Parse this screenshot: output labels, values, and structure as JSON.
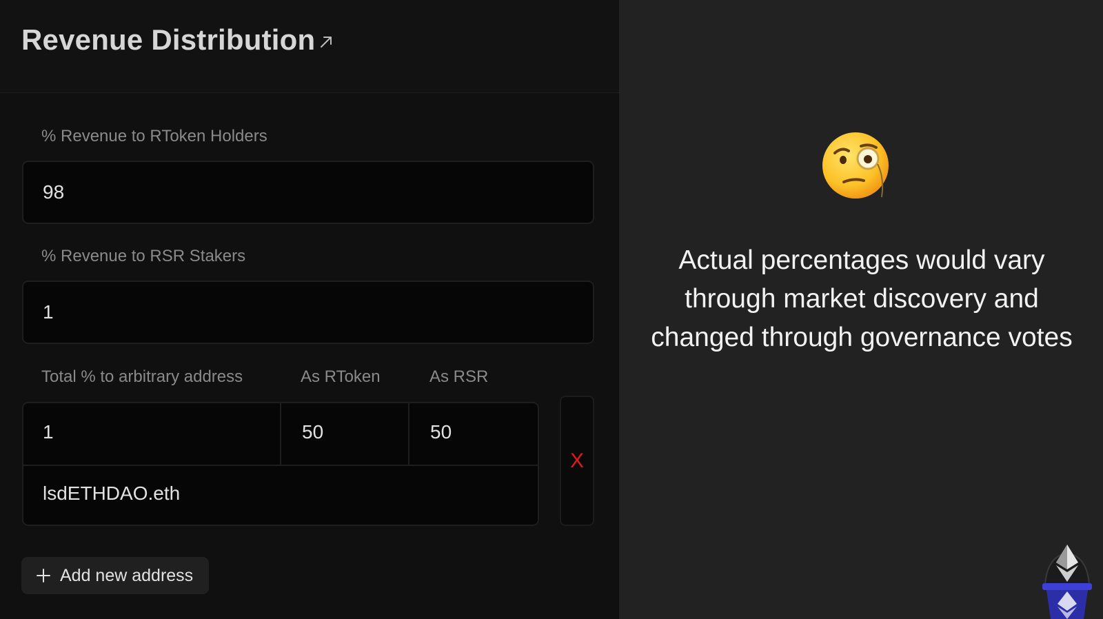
{
  "header": {
    "title": "Revenue Distribution",
    "external_icon": "external-link-icon"
  },
  "fields": {
    "rtoken_holders": {
      "label": "% Revenue to RToken Holders",
      "value": "98"
    },
    "rsr_stakers": {
      "label": "% Revenue to RSR Stakers",
      "value": "1"
    }
  },
  "arbitrary": {
    "label_total": "Total % to arbitrary address",
    "label_rtoken": "As RToken",
    "label_rsr": "As RSR",
    "total": "1",
    "as_rtoken": "50",
    "as_rsr": "50",
    "address": "lsdETHDAO.eth",
    "remove_label": "X"
  },
  "add_button": {
    "label": "Add new address",
    "icon": "plus-icon"
  },
  "caption": {
    "line1": "Actual percentages would vary",
    "line2": "through market discovery and",
    "line3": "changed through governance votes"
  },
  "colors": {
    "remove": "#e0191e",
    "panel": "#101010",
    "backdrop": "#222222"
  }
}
